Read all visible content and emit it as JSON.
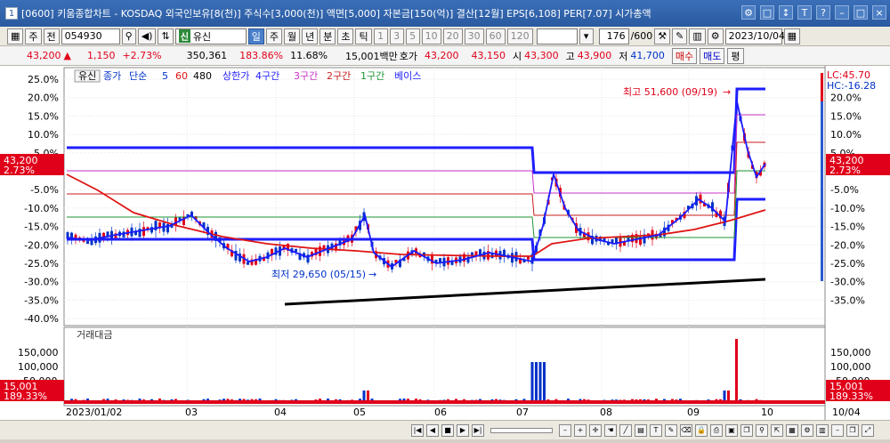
{
  "window": {
    "number": "1",
    "title": "[0600] 키움종합차트 - KOSDAQ 외국인보유[8(천)] 주식수[3,000(천)] 액면[5,000] 자본금[150(억)] 결산[12월] EPS[6,108] PER[7.07] 시가총액",
    "controls": [
      "⚙",
      "□",
      "↕",
      "T",
      "?",
      "–",
      "□",
      "×"
    ]
  },
  "toolbar": {
    "market": "주",
    "period_label": "전",
    "code": "054930",
    "stock_badge": "신",
    "stock_name": "유신",
    "period_buttons": [
      "일",
      "주",
      "월",
      "년",
      "분",
      "초",
      "틱"
    ],
    "tick_buttons": [
      "1",
      "3",
      "5",
      "10",
      "20",
      "30",
      "60",
      "120"
    ],
    "count": "176",
    "total": "/600",
    "date": "2023/10/04"
  },
  "quote": {
    "price": "43,200",
    "arrow": "▲",
    "change": "1,150",
    "change_pct": "+2.73%",
    "volume": "350,361",
    "vol_ratio": "183.86%",
    "turnover": "11.68%",
    "trade_value": "15,001백만",
    "bid_label": "호가",
    "bid": "43,200",
    "ask": "43,150",
    "open_label": "시",
    "open": "43,300",
    "high_label": "고",
    "high": "43,900",
    "low_label": "저",
    "low": "41,700",
    "buy": "매수",
    "sell": "매도",
    "eval": "평"
  },
  "legend": {
    "stock": "유신",
    "close": "종가",
    "ma_label": "단순",
    "ma5": "5",
    "ma60": "60",
    "ma480": "480",
    "upper": "상한가",
    "zone4": "4구간",
    "zone3": "3구간",
    "zone2": "2구간",
    "zone1": "1구간",
    "base": "베이스"
  },
  "annotations": {
    "high": "최고 51,600 (09/19)",
    "low": "최저 29,650 (05/15)",
    "lc": "LC:45.70",
    "hc": "HC:-16.28"
  },
  "axis": {
    "price_ticks": [
      "25.0%",
      "20.0%",
      "15.0%",
      "10.0%",
      "5.0%",
      "0.0%",
      "-5.0%",
      "-10.0%",
      "-15.0%",
      "-20.0%",
      "-25.0%",
      "-30.0%",
      "-35.0%",
      "-40.0%"
    ],
    "right_ticks": [
      "20.0%",
      "15.0%",
      "10.0%",
      "5.0%",
      "-5.0%",
      "-10.0%",
      "-15.0%",
      "-20.0%",
      "-25.0%",
      "-30.0%",
      "-35.0%"
    ],
    "price_box": "43,200",
    "price_box_pct": "2.73%",
    "vol_title": "거래대금",
    "vol_ticks": [
      "150,000",
      "100,000",
      "50,000"
    ],
    "vol_box": "15,001",
    "vol_box_pct": "189.33%",
    "dates": [
      "2023/01/02",
      "03",
      "04",
      "05",
      "06",
      "07",
      "08",
      "09",
      "10"
    ],
    "right_date": "10/04"
  },
  "colors": {
    "up": "#e0001a",
    "down": "#0032c8",
    "ma5": "#1a1aff",
    "ma60": "#e01414",
    "upper": "#1e1eff",
    "zone3": "#c832c8",
    "zone2": "#c81e1e",
    "zone1": "#1e9632",
    "trend": "#000000"
  }
}
